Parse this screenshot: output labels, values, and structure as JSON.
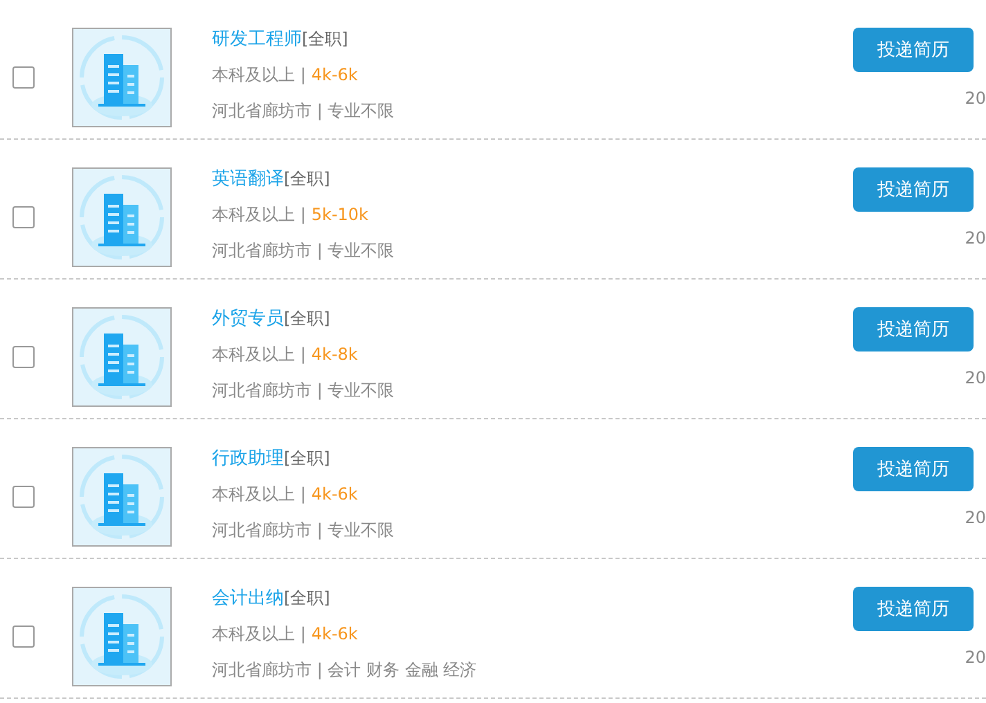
{
  "jobs": [
    {
      "checked": false,
      "title": "研发工程师",
      "type": "[全职]",
      "education": "本科及以上 |",
      "salary": "4k-6k",
      "details": "河北省廊坊市 | 专业不限",
      "button": "投递简历",
      "date": "20"
    },
    {
      "checked": false,
      "title": "英语翻译",
      "type": "[全职]",
      "education": "本科及以上 |",
      "salary": "5k-10k",
      "details": "河北省廊坊市 | 专业不限",
      "button": "投递简历",
      "date": "20"
    },
    {
      "checked": false,
      "title": "外贸专员",
      "type": "[全职]",
      "education": "本科及以上 |",
      "salary": "4k-8k",
      "details": "河北省廊坊市 | 专业不限",
      "button": "投递简历",
      "date": "20"
    },
    {
      "checked": false,
      "title": "行政助理",
      "type": "[全职]",
      "education": "本科及以上 |",
      "salary": "4k-6k",
      "details": "河北省廊坊市 | 专业不限",
      "button": "投递简历",
      "date": "20"
    },
    {
      "checked": false,
      "title": "会计出纳",
      "type": "[全职]",
      "education": "本科及以上 |",
      "salary": "4k-6k",
      "details": "河北省廊坊市 | 会计 财务 金融 经济",
      "button": "投递简历",
      "date": "20"
    }
  ]
}
